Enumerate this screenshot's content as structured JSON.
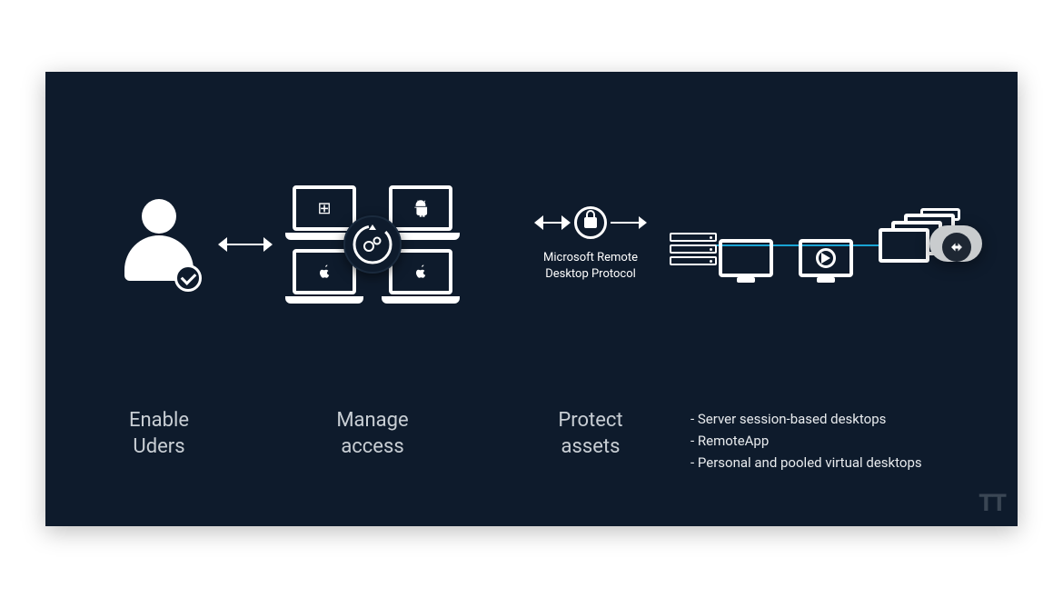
{
  "labels": {
    "enable_users_l1": "Enable",
    "enable_users_l2": "Uders",
    "manage_access_l1": "Manage",
    "manage_access_l2": "access",
    "protect_assets_l1": "Protect",
    "protect_assets_l2": "assets",
    "rdp_l1": "Microsoft Remote",
    "rdp_l2": "Desktop Protocol"
  },
  "bullets": {
    "b1": "Server session-based desktops",
    "b2": "RemoteApp",
    "b3": "Personal and pooled virtual desktops"
  },
  "os": {
    "windows": "⊞",
    "android": "◖◗",
    "apple1": "",
    "apple2": ""
  },
  "watermark": "TT"
}
